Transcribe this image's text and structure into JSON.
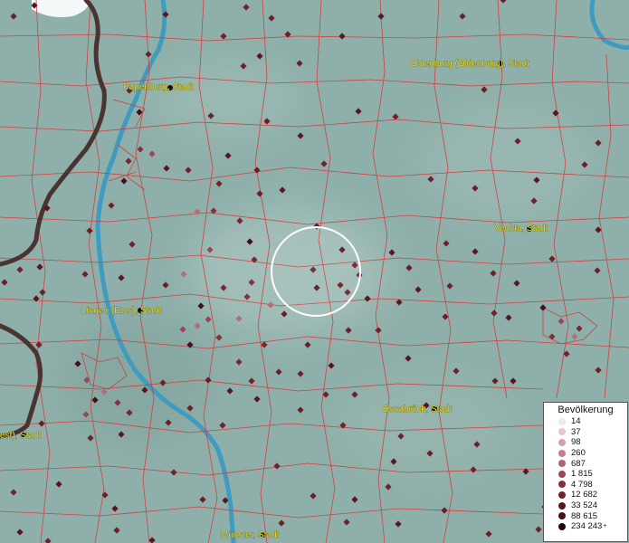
{
  "colors": {
    "land": "#8fb0aa",
    "river": "#3f9bbf",
    "border": "#d83434",
    "national_border": "#4a3432",
    "marker": "#6b1f24",
    "label": "#f0e020",
    "selection_ring": "#ffffff"
  },
  "cities": [
    {
      "name": "Oldenburg (Oldenburg), Stadt"
    },
    {
      "name": "Papenburg, Stadt"
    },
    {
      "name": "Vechta, Stadt"
    },
    {
      "name": "Lingen (Ems), Stadt"
    },
    {
      "name": "Osnabrück, Stadt"
    },
    {
      "name": "esf), Stadt"
    },
    {
      "name": "Münster, Stadt"
    }
  ],
  "legend": {
    "title": "Bevölkerung",
    "items": [
      {
        "label": "14",
        "color": "#f4e6ee"
      },
      {
        "label": "37",
        "color": "#e6c4d0"
      },
      {
        "label": "98",
        "color": "#d4a0b0"
      },
      {
        "label": "260",
        "color": "#c28090"
      },
      {
        "label": "687",
        "color": "#ae6274"
      },
      {
        "label": "1 815",
        "color": "#9a4658"
      },
      {
        "label": "4 798",
        "color": "#86303f"
      },
      {
        "label": "12 682",
        "color": "#70202e"
      },
      {
        "label": "33 524",
        "color": "#5a1620"
      },
      {
        "label": "88 615",
        "color": "#420e16"
      },
      {
        "label": "234 243",
        "color": "#24060a",
        "suffix": "+"
      }
    ]
  },
  "icons": [
    "place-marker-icon",
    "selection-ring-icon",
    "city-point-icon"
  ]
}
